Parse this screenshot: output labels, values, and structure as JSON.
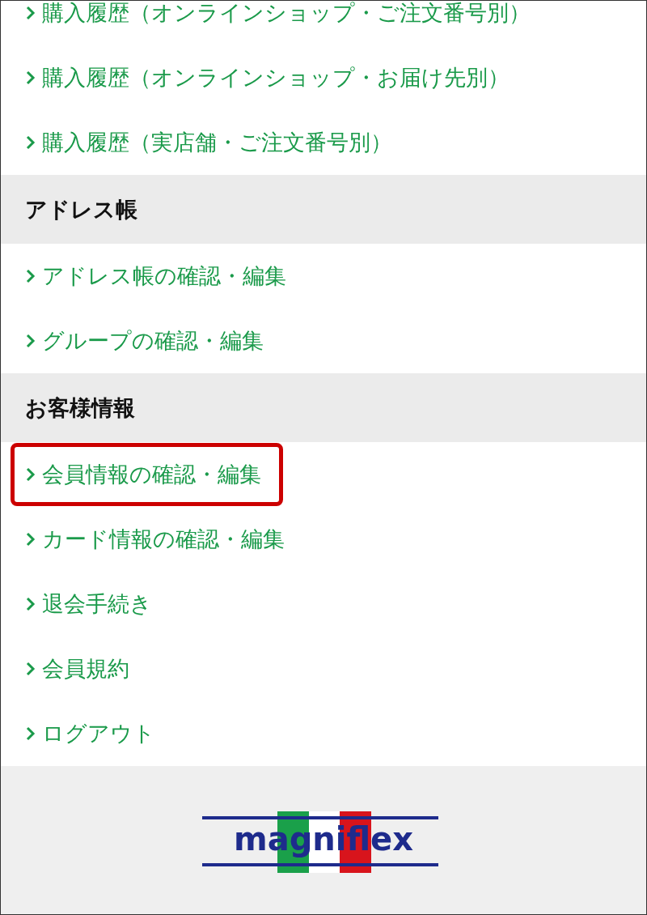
{
  "sections": [
    {
      "items": [
        {
          "label": "購入履歴（オンラインショップ・ご注文番号別）",
          "highlighted": false
        },
        {
          "label": "購入履歴（オンラインショップ・お届け先別）",
          "highlighted": false
        },
        {
          "label": "購入履歴（実店舗・ご注文番号別）",
          "highlighted": false
        }
      ]
    },
    {
      "heading": "アドレス帳",
      "items": [
        {
          "label": "アドレス帳の確認・編集",
          "highlighted": false
        },
        {
          "label": "グループの確認・編集",
          "highlighted": false
        }
      ]
    },
    {
      "heading": "お客様情報",
      "items": [
        {
          "label": "会員情報の確認・編集",
          "highlighted": true
        },
        {
          "label": "カード情報の確認・編集",
          "highlighted": false
        },
        {
          "label": "退会手続き",
          "highlighted": false
        },
        {
          "label": "会員規約",
          "highlighted": false
        },
        {
          "label": "ログアウト",
          "highlighted": false
        }
      ]
    }
  ],
  "footer": {
    "logo": "magniflex"
  }
}
